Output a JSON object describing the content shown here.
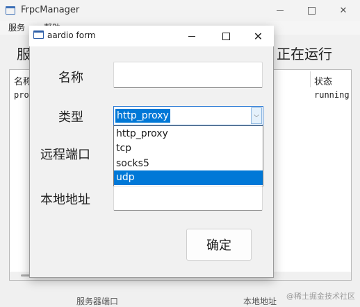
{
  "main_window": {
    "title": "FrpcManager",
    "menu": [
      "服务",
      "帮助"
    ],
    "status_left": "服",
    "status_right": "正在运行",
    "list": {
      "columns": [
        "名称",
        "状态"
      ],
      "rows": [
        {
          "name": "pro",
          "status": "running"
        }
      ]
    },
    "bottom_left": "服务器端口",
    "bottom_right": "本地地址"
  },
  "watermark": "@稀土掘金技术社区",
  "dialog": {
    "title": "aardio form",
    "labels": {
      "name": "名称",
      "type": "类型",
      "remote_port": "远程端口",
      "local_addr": "本地地址"
    },
    "fields": {
      "name_value": "",
      "local_addr_value": ""
    },
    "type_combo": {
      "selected": "http_proxy",
      "options": [
        "http_proxy",
        "tcp",
        "socks5",
        "udp"
      ],
      "highlighted": "udp"
    },
    "ok_label": "确定",
    "close_glyph": "✕"
  },
  "icons": {
    "combo_arrow": "chevron-down-icon"
  },
  "colors": {
    "accent": "#0078d7",
    "combo_border": "#2a7ad5"
  }
}
